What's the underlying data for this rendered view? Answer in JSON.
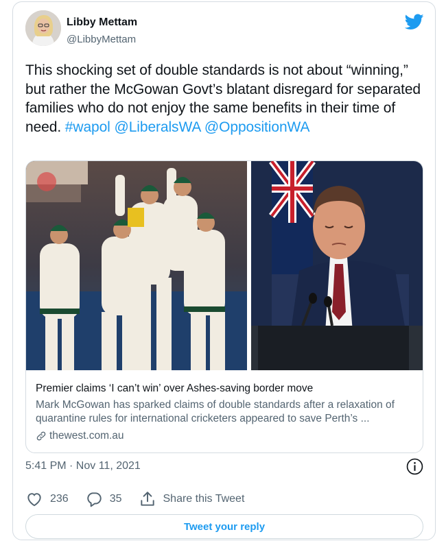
{
  "author": {
    "name": "Libby Mettam",
    "handle": "@LibbyMettam",
    "avatar_icon": "profile-photo"
  },
  "brand": {
    "icon": "twitter-bird-icon",
    "color": "#1d9bf0"
  },
  "tweet": {
    "text_plain": "This shocking set of double standards is not about “winning,” but rather the McGowan Govt’s blatant disregard for separated families who do not enjoy the same benefits in their time of need. ",
    "hashtag": "#wapol",
    "mention_1": "@LiberalsWA",
    "mention_2": "@OppositionWA"
  },
  "link_card": {
    "title": "Premier claims ‘I can’t win’ over Ashes-saving border move",
    "description": "Mark McGowan has sparked claims of double standards after a relaxation of quarantine rules for international cricketers appeared to save Perth’s ...",
    "domain": "thewest.com.au"
  },
  "timestamp": "5:41 PM · Nov 11, 2021",
  "actions": {
    "likes": "236",
    "replies": "35",
    "share_label": "Share this Tweet"
  },
  "reply_button": "Tweet your reply",
  "colors": {
    "link": "#1d9bf0",
    "text": "#0f1419",
    "secondary": "#536471",
    "border": "#d4dbe1"
  }
}
